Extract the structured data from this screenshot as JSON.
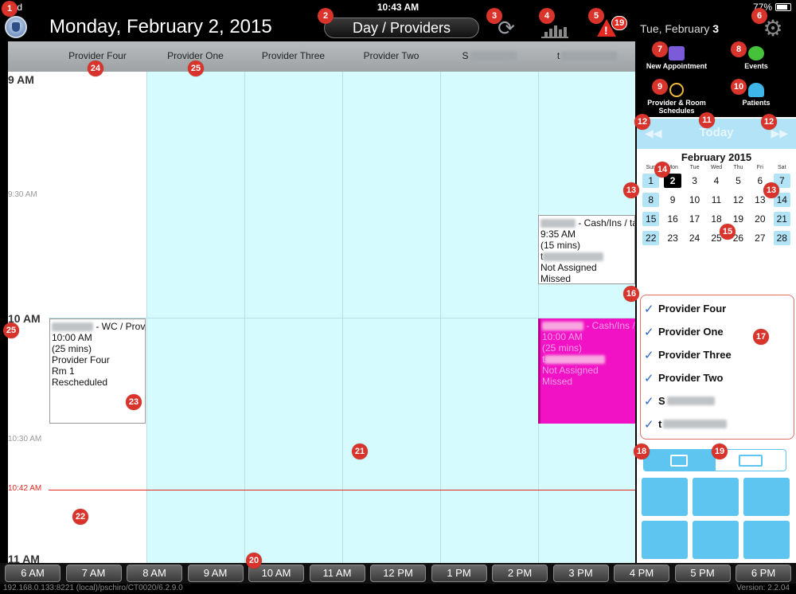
{
  "status_bar": {
    "device": "iPad",
    "time": "10:43 AM",
    "battery": "77%"
  },
  "header": {
    "date_title": "Monday, February 2, 2015",
    "view_button": "Day / Providers",
    "alert_count": "19",
    "short_date_prefix": "Tue, February",
    "short_date_day": "3"
  },
  "providers": [
    "Provider Four",
    "Provider One",
    "Provider Three",
    "Provider Two",
    "S",
    "t"
  ],
  "time_axis": {
    "t9": "9 AM",
    "t930": "9:30 AM",
    "t10": "10 AM",
    "t1030": "10:30 AM",
    "now": "10:42 AM",
    "t11": "11 AM"
  },
  "appointments": [
    {
      "title_suffix": "- WC / Prov",
      "time": "10:00 AM",
      "duration": "(25 mins)",
      "provider": "Provider Four",
      "room": "Rm 1",
      "status": "Rescheduled"
    },
    {
      "title_suffix": "- Cash/Ins / ta",
      "time": "9:35 AM",
      "duration": "(15 mins)",
      "provider_initial": "t",
      "assigned": "Not Assigned",
      "status": "Missed"
    },
    {
      "title_suffix": "- Cash/Ins /",
      "time": "10:00 AM",
      "duration": "(25 mins)",
      "provider_initial": "t",
      "assigned": "Not Assigned",
      "status": "Missed"
    }
  ],
  "quick_actions": {
    "new_appointment": "New Appointment",
    "events": "Events",
    "schedules": "Provider & Room Schedules",
    "patients": "Patients"
  },
  "today_label": "Today",
  "calendar": {
    "title": "February 2015",
    "weekdays": [
      "Sun",
      "Mon",
      "Tue",
      "Wed",
      "Thu",
      "Fri",
      "Sat"
    ],
    "days": [
      "1",
      "2",
      "3",
      "4",
      "5",
      "6",
      "7",
      "8",
      "9",
      "10",
      "11",
      "12",
      "13",
      "14",
      "15",
      "16",
      "17",
      "18",
      "19",
      "20",
      "21",
      "22",
      "23",
      "24",
      "25",
      "26",
      "27",
      "28"
    ],
    "selected": "2"
  },
  "provider_filter": [
    "Provider Four",
    "Provider One",
    "Provider Three",
    "Provider Two",
    "S",
    "t"
  ],
  "hour_buttons": [
    "6 AM",
    "7 AM",
    "8 AM",
    "9 AM",
    "10 AM",
    "11 AM",
    "12 PM",
    "1 PM",
    "2 PM",
    "3 PM",
    "4 PM",
    "5 PM",
    "6 PM"
  ],
  "footer": {
    "server": "192.168.0.133:8221 (local)/pschiro/CT0020/6.2.9.0",
    "version": "Version: 2.2.04"
  },
  "badges": [
    "1",
    "2",
    "3",
    "4",
    "5",
    "6",
    "7",
    "8",
    "9",
    "10",
    "11",
    "12",
    "12",
    "13",
    "13",
    "14",
    "15",
    "16",
    "17",
    "18",
    "19",
    "20",
    "21",
    "22",
    "23",
    "24",
    "25",
    "25"
  ],
  "colors": {
    "grid_bg": "#d6fbfe",
    "accent_blue": "#5ec5f0",
    "missed_pink": "#f112c5",
    "badge_red": "#d9342b"
  }
}
